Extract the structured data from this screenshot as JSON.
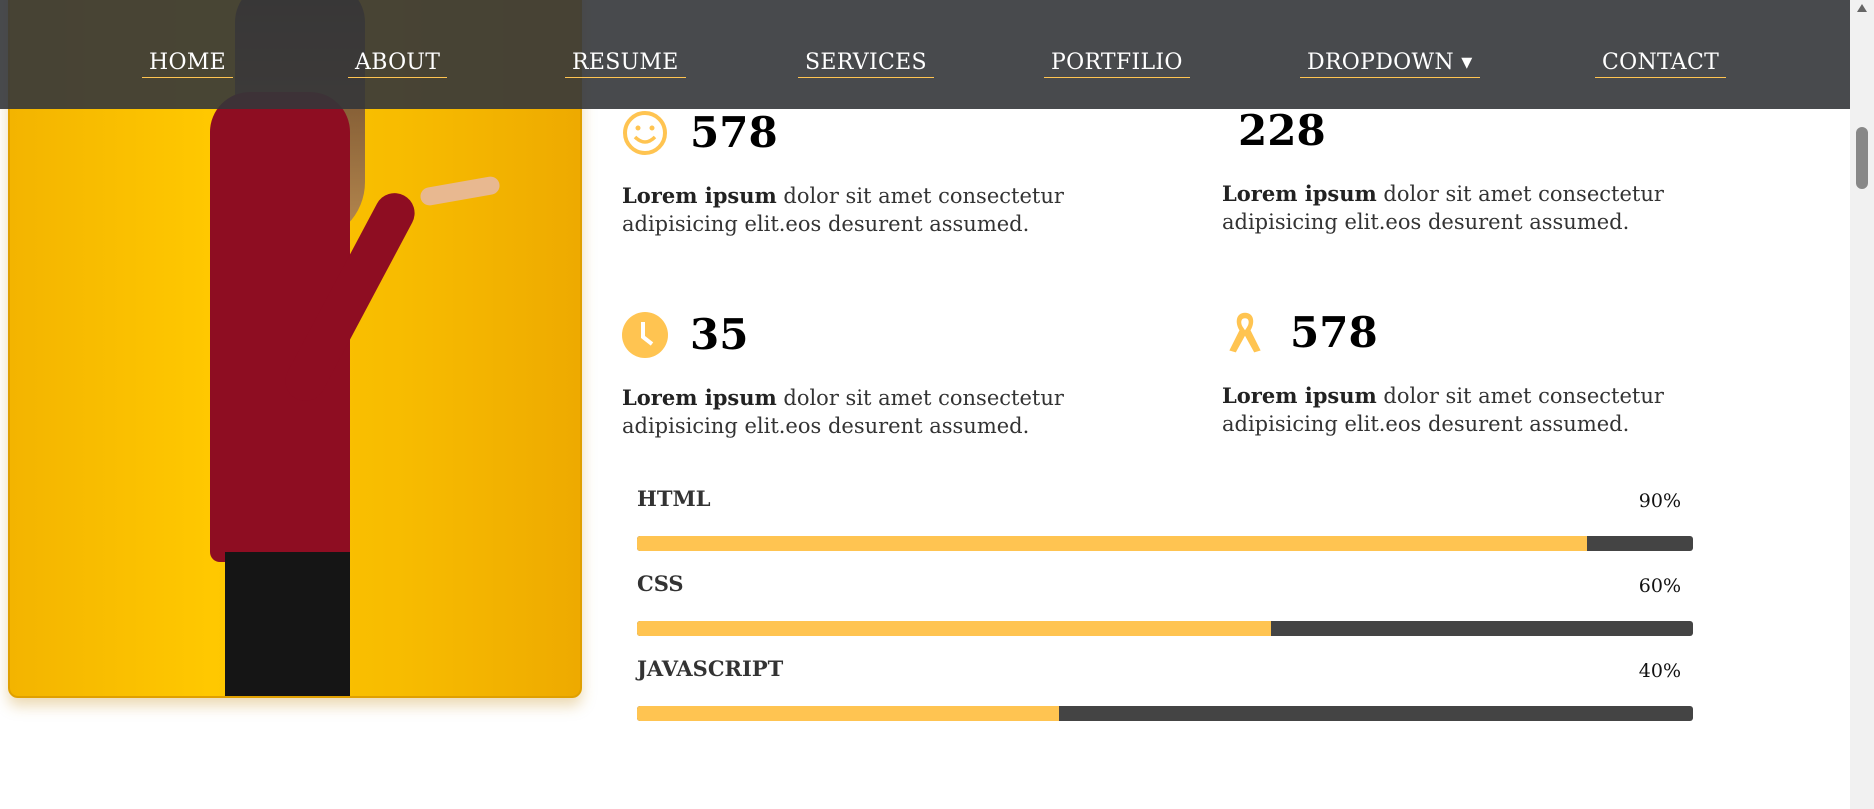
{
  "nav": {
    "items": [
      {
        "label": "HOME"
      },
      {
        "label": "ABOUT"
      },
      {
        "label": "RESUME"
      },
      {
        "label": "SERVICES"
      },
      {
        "label": "PORTFILIO"
      },
      {
        "label": "DROPDOWN ▾"
      },
      {
        "label": "CONTACT"
      }
    ]
  },
  "stats": [
    {
      "icon": "smile-icon",
      "number": "578",
      "bold": "Lorem ipsum",
      "text": " dolor sit amet consectetur adipisicing elit.eos desurent assumed."
    },
    {
      "icon": "none",
      "number": "228",
      "bold": "Lorem ipsum",
      "text": " dolor sit amet consectetur adipisicing elit.eos desurent assumed."
    },
    {
      "icon": "clock-icon",
      "number": "35",
      "bold": "Lorem ipsum",
      "text": " dolor sit amet consectetur adipisicing elit.eos desurent assumed."
    },
    {
      "icon": "award-ribbon-icon",
      "number": "578",
      "bold": "Lorem ipsum",
      "text": " dolor sit amet consectetur adipisicing elit.eos desurent assumed."
    }
  ],
  "skills": [
    {
      "name": "HTML",
      "percent_label": "90%",
      "value": 90
    },
    {
      "name": "CSS",
      "percent_label": "60%",
      "value": 60
    },
    {
      "name": "JAVASCRIPT",
      "percent_label": "40%",
      "value": 40
    }
  ],
  "colors": {
    "accent": "#ffc451",
    "nav_bg": "#34363a",
    "bar_bg": "#444444"
  }
}
